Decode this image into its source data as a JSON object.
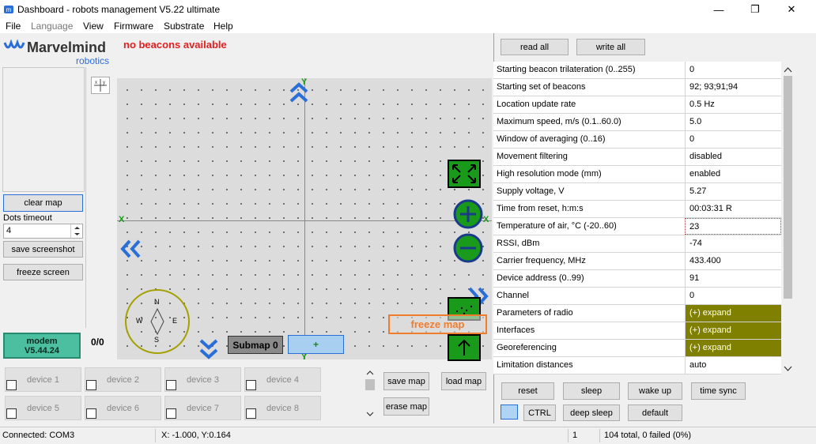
{
  "window": {
    "title": "Dashboard - robots management   V5.22   ultimate",
    "minimize": "—",
    "maximize": "❐",
    "close": "✕"
  },
  "menu": [
    "File",
    "Language",
    "View",
    "Firmware",
    "Substrate",
    "Help"
  ],
  "logo": {
    "name": "Marvelmind",
    "sub": "robotics"
  },
  "map": {
    "alert": "no beacons available",
    "axis_x": "X",
    "axis_y": "Y",
    "submap_label": "Submap 0",
    "add_submap": "+",
    "freeze_label": "freeze map",
    "compass": {
      "n": "N",
      "s": "S",
      "w": "W",
      "e": "E"
    }
  },
  "left": {
    "clear_map": "clear map",
    "dots_timeout_label": "Dots timeout",
    "dots_timeout_value": "4",
    "save_screenshot": "save screenshot",
    "freeze_screen": "freeze screen",
    "modem_line1": "modem",
    "modem_line2": "V5.44.24",
    "counter": "0/0"
  },
  "devices": [
    {
      "label": "device 1"
    },
    {
      "label": "device 2"
    },
    {
      "label": "device 3"
    },
    {
      "label": "device 4"
    },
    {
      "label": "device 5"
    },
    {
      "label": "device 6"
    },
    {
      "label": "device 7"
    },
    {
      "label": "device 8"
    }
  ],
  "map_actions": {
    "save_map": "save map",
    "load_map": "load map",
    "erase_map": "erase map"
  },
  "right": {
    "read_all": "read all",
    "write_all": "write all",
    "rows": [
      {
        "k": "Starting beacon trilateration (0..255)",
        "v": "0"
      },
      {
        "k": "Starting set of beacons",
        "v": "92;  93;91;94"
      },
      {
        "k": "Location update rate",
        "v": "0.5 Hz"
      },
      {
        "k": "Maximum speed, m/s (0.1..60.0)",
        "v": "5.0"
      },
      {
        "k": "Window of averaging (0..16)",
        "v": "0"
      },
      {
        "k": "Movement filtering",
        "v": "disabled"
      },
      {
        "k": "High resolution mode (mm)",
        "v": "enabled"
      },
      {
        "k": "Supply voltage, V",
        "v": "5.27"
      },
      {
        "k": "Time from reset, h:m:s",
        "v": "00:03:31   R"
      },
      {
        "k": "Temperature of air, °C (-20..60)",
        "v": "23"
      },
      {
        "k": "RSSI, dBm",
        "v": "-74"
      },
      {
        "k": "Carrier frequency, MHz",
        "v": "433.400"
      },
      {
        "k": "Device address (0..99)",
        "v": "91"
      },
      {
        "k": "Channel",
        "v": "0"
      },
      {
        "k": "Parameters of radio",
        "v": "(+) expand",
        "olive": true
      },
      {
        "k": "Interfaces",
        "v": "(+) expand",
        "olive": true
      },
      {
        "k": "Georeferencing",
        "v": "(+) expand",
        "olive": true
      },
      {
        "k": "Limitation distances",
        "v": "auto"
      }
    ],
    "actions": {
      "reset": "reset",
      "sleep": "sleep",
      "wake_up": "wake up",
      "time_sync": "time sync",
      "ctrl": "CTRL",
      "deep_sleep": "deep sleep",
      "default": "default"
    }
  },
  "status": {
    "connection": "Connected: COM3",
    "coords": "X: -1.000, Y:0.164",
    "count": "1",
    "totals": "104 total, 0 failed (0%)"
  },
  "colors": {
    "olive": "#808000",
    "modem_green": "#4cbfa0",
    "map_blue": "#2a6ed8",
    "alert_red": "#e02020",
    "freeze_orange": "#f07c2e"
  }
}
